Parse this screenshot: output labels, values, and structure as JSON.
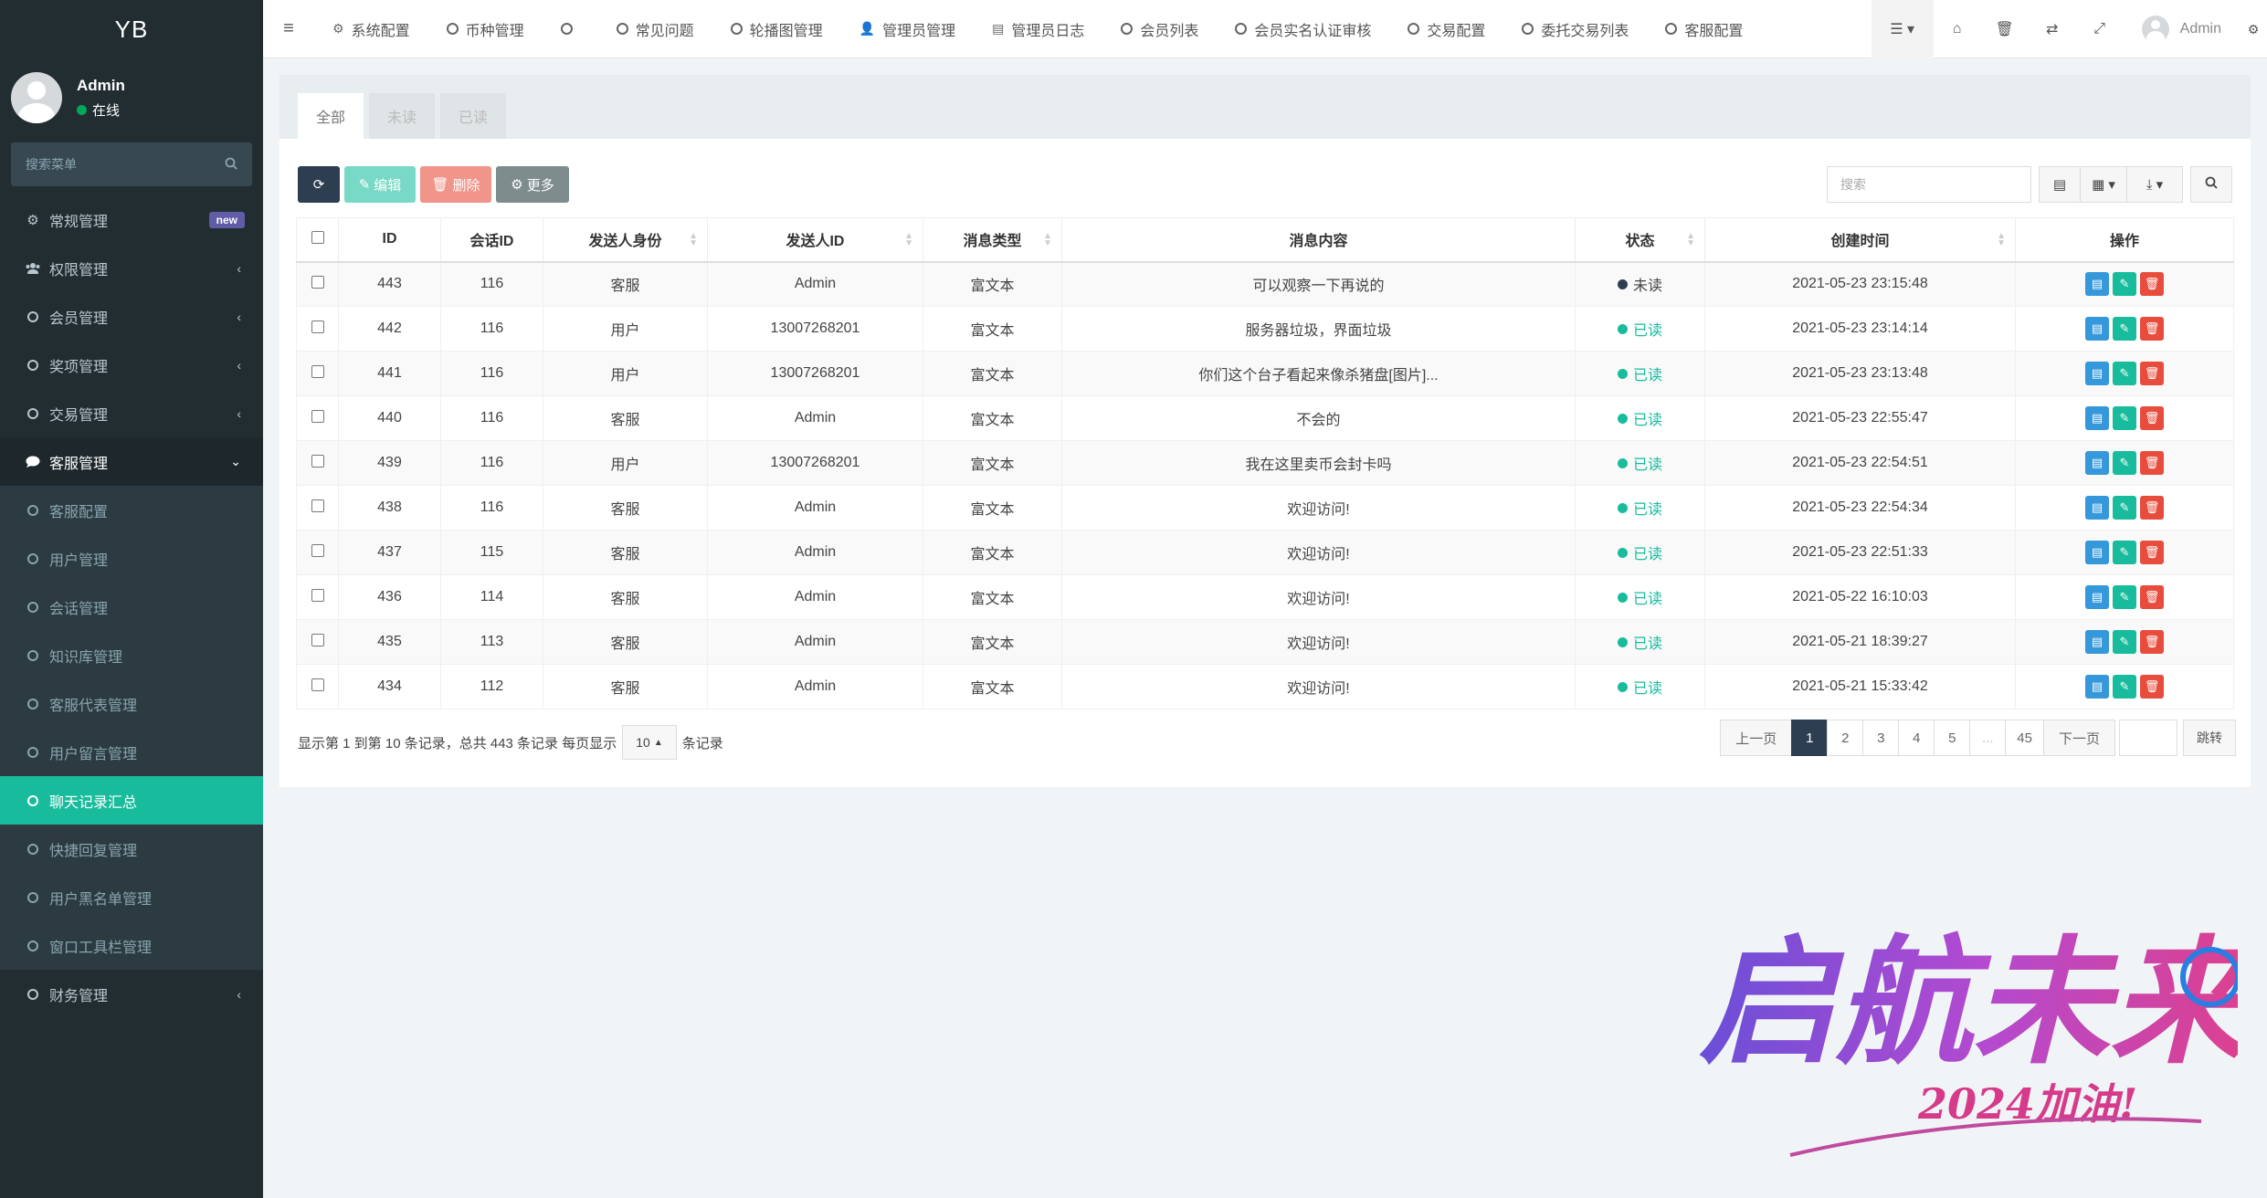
{
  "brand": "YB",
  "user": {
    "name": "Admin",
    "status": "在线"
  },
  "sidebar": {
    "search_placeholder": "搜索菜单",
    "items": [
      {
        "label": "常规管理",
        "icon": "cogs-icon",
        "badge": "new"
      },
      {
        "label": "权限管理",
        "icon": "group-icon"
      },
      {
        "label": "会员管理",
        "icon": "circle-icon"
      },
      {
        "label": "奖项管理",
        "icon": "circle-icon"
      },
      {
        "label": "交易管理",
        "icon": "circle-icon"
      },
      {
        "label": "客服管理",
        "icon": "comment-icon"
      },
      {
        "label": "客服配置",
        "icon": "circle-icon"
      },
      {
        "label": "用户管理",
        "icon": "circle-icon"
      },
      {
        "label": "会话管理",
        "icon": "circle-icon"
      },
      {
        "label": "知识库管理",
        "icon": "circle-icon"
      },
      {
        "label": "客服代表管理",
        "icon": "circle-icon"
      },
      {
        "label": "用户留言管理",
        "icon": "circle-icon"
      },
      {
        "label": "聊天记录汇总",
        "icon": "circle-icon"
      },
      {
        "label": "快捷回复管理",
        "icon": "circle-icon"
      },
      {
        "label": "用户黑名单管理",
        "icon": "circle-icon"
      },
      {
        "label": "窗口工具栏管理",
        "icon": "circle-icon"
      },
      {
        "label": "财务管理",
        "icon": "circle-icon"
      }
    ]
  },
  "topnav": {
    "tabs": [
      {
        "label": "系统配置",
        "icon": "cog-icon"
      },
      {
        "label": "币种管理",
        "icon": "circle-icon"
      },
      {
        "label": "",
        "icon": "circle-icon"
      },
      {
        "label": "常见问题",
        "icon": "circle-icon"
      },
      {
        "label": "轮播图管理",
        "icon": "circle-icon"
      },
      {
        "label": "管理员管理",
        "icon": "user-icon"
      },
      {
        "label": "管理员日志",
        "icon": "list-alt-icon"
      },
      {
        "label": "会员列表",
        "icon": "circle-icon"
      },
      {
        "label": "会员实名认证审核",
        "icon": "circle-icon"
      },
      {
        "label": "交易配置",
        "icon": "circle-icon"
      },
      {
        "label": "委托交易列表",
        "icon": "circle-icon"
      },
      {
        "label": "客服配置",
        "icon": "circle-icon"
      }
    ],
    "user_name": "Admin"
  },
  "tabs": {
    "all": "全部",
    "unread": "未读",
    "read": "已读"
  },
  "toolbar": {
    "edit": "编辑",
    "delete": "删除",
    "more": "更多",
    "search_placeholder": "搜索"
  },
  "table": {
    "headers": {
      "id": "ID",
      "session_id": "会话ID",
      "sender_role": "发送人身份",
      "sender_id": "发送人ID",
      "msg_type": "消息类型",
      "content": "消息内容",
      "status": "状态",
      "created": "创建时间",
      "ops": "操作"
    },
    "rows": [
      {
        "id": "443",
        "session": "116",
        "role": "客服",
        "role_type": "staff",
        "sender": "Admin",
        "type": "富文本",
        "content": "可以观察一下再说的",
        "status": "未读",
        "status_type": "unread",
        "created": "2021-05-23 23:15:48"
      },
      {
        "id": "442",
        "session": "116",
        "role": "用户",
        "role_type": "user",
        "sender": "13007268201",
        "type": "富文本",
        "content": "服务器垃圾，界面垃圾",
        "status": "已读",
        "status_type": "read",
        "created": "2021-05-23 23:14:14"
      },
      {
        "id": "441",
        "session": "116",
        "role": "用户",
        "role_type": "user",
        "sender": "13007268201",
        "type": "富文本",
        "content": "你们这个台子看起来像杀猪盘[图片]...",
        "status": "已读",
        "status_type": "read",
        "created": "2021-05-23 23:13:48"
      },
      {
        "id": "440",
        "session": "116",
        "role": "客服",
        "role_type": "staff",
        "sender": "Admin",
        "type": "富文本",
        "content": "不会的",
        "status": "已读",
        "status_type": "read",
        "created": "2021-05-23 22:55:47"
      },
      {
        "id": "439",
        "session": "116",
        "role": "用户",
        "role_type": "user",
        "sender": "13007268201",
        "type": "富文本",
        "content": "我在这里卖币会封卡吗",
        "status": "已读",
        "status_type": "read",
        "created": "2021-05-23 22:54:51"
      },
      {
        "id": "438",
        "session": "116",
        "role": "客服",
        "role_type": "staff",
        "sender": "Admin",
        "type": "富文本",
        "content": "欢迎访问!",
        "status": "已读",
        "status_type": "read",
        "created": "2021-05-23 22:54:34"
      },
      {
        "id": "437",
        "session": "115",
        "role": "客服",
        "role_type": "staff",
        "sender": "Admin",
        "type": "富文本",
        "content": "欢迎访问!",
        "status": "已读",
        "status_type": "read",
        "created": "2021-05-23 22:51:33"
      },
      {
        "id": "436",
        "session": "114",
        "role": "客服",
        "role_type": "staff",
        "sender": "Admin",
        "type": "富文本",
        "content": "欢迎访问!",
        "status": "已读",
        "status_type": "read",
        "created": "2021-05-22 16:10:03"
      },
      {
        "id": "435",
        "session": "113",
        "role": "客服",
        "role_type": "staff",
        "sender": "Admin",
        "type": "富文本",
        "content": "欢迎访问!",
        "status": "已读",
        "status_type": "read",
        "created": "2021-05-21 18:39:27"
      },
      {
        "id": "434",
        "session": "112",
        "role": "客服",
        "role_type": "staff",
        "sender": "Admin",
        "type": "富文本",
        "content": "欢迎访问!",
        "status": "已读",
        "status_type": "read",
        "created": "2021-05-21 15:33:42"
      }
    ]
  },
  "pagination": {
    "info": "显示第 1 到第 10 条记录，总共 443 条记录 每页显示",
    "page_size": "10",
    "suffix": "条记录",
    "prev": "上一页",
    "pages": [
      "1",
      "2",
      "3",
      "4",
      "5",
      "...",
      "45"
    ],
    "next": "下一页",
    "jump": "跳转"
  },
  "watermark": {
    "main": "启航未来",
    "sub": "2024加油!"
  },
  "colors": {
    "sidebar_bg": "#222d32",
    "accent": "#18bc9c",
    "dark": "#2c3e50",
    "danger": "#e74c3c",
    "info": "#3498db"
  }
}
